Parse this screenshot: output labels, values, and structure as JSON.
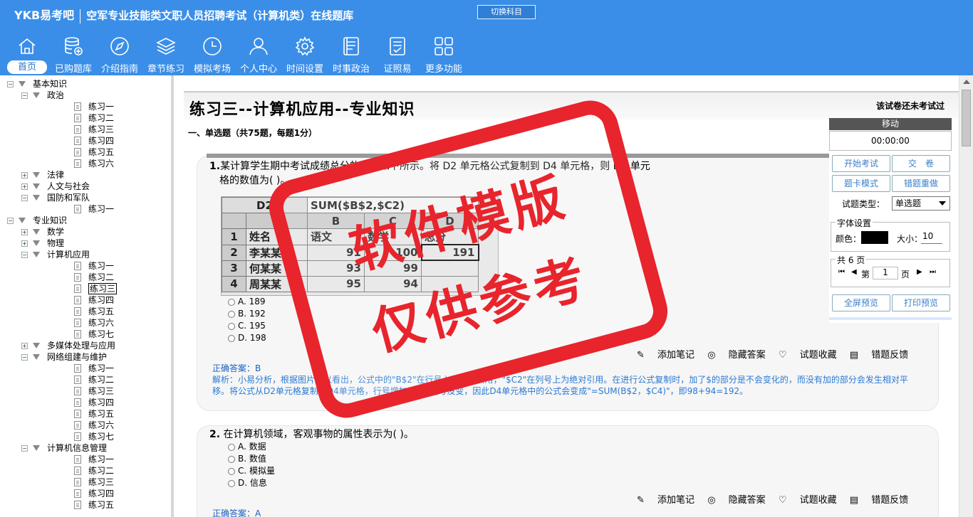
{
  "header": {
    "brand": "YKB易考吧",
    "exam_name": "空军专业技能类文职人员招聘考试（计算机类）在线题库",
    "switch_label": "切换科目"
  },
  "nav": [
    {
      "label": "首页",
      "icon": "home-icon"
    },
    {
      "label": "已购题库",
      "icon": "database-icon"
    },
    {
      "label": "介绍指南",
      "icon": "compass-icon"
    },
    {
      "label": "章节练习",
      "icon": "layers-icon"
    },
    {
      "label": "模拟考场",
      "icon": "clock-icon"
    },
    {
      "label": "个人中心",
      "icon": "user-icon"
    },
    {
      "label": "时间设置",
      "icon": "gear-icon"
    },
    {
      "label": "时事政治",
      "icon": "news-icon"
    },
    {
      "label": "证照易",
      "icon": "checklist-icon"
    },
    {
      "label": "更多功能",
      "icon": "grid-icon"
    }
  ],
  "tree": [
    {
      "level": 0,
      "label": "基本知识",
      "kind": "folder"
    },
    {
      "level": 1,
      "label": "政治",
      "kind": "folder"
    },
    {
      "level": 2,
      "label": "练习一",
      "kind": "doc"
    },
    {
      "level": 2,
      "label": "练习二",
      "kind": "doc"
    },
    {
      "level": 2,
      "label": "练习三",
      "kind": "doc"
    },
    {
      "level": 2,
      "label": "练习四",
      "kind": "doc"
    },
    {
      "level": 2,
      "label": "练习五",
      "kind": "doc"
    },
    {
      "level": 2,
      "label": "练习六",
      "kind": "doc"
    },
    {
      "level": 1,
      "label": "法律",
      "kind": "collapsed"
    },
    {
      "level": 1,
      "label": "人文与社会",
      "kind": "collapsed"
    },
    {
      "level": 1,
      "label": "国防和军队",
      "kind": "folder"
    },
    {
      "level": 2,
      "label": "练习一",
      "kind": "doc"
    },
    {
      "level": 0,
      "label": "专业知识",
      "kind": "folder"
    },
    {
      "level": 1,
      "label": "数学",
      "kind": "collapsed"
    },
    {
      "level": 1,
      "label": "物理",
      "kind": "collapsed"
    },
    {
      "level": 1,
      "label": "计算机应用",
      "kind": "folder"
    },
    {
      "level": 2,
      "label": "练习一",
      "kind": "doc"
    },
    {
      "level": 2,
      "label": "练习二",
      "kind": "doc"
    },
    {
      "level": 2,
      "label": "练习三",
      "kind": "doc",
      "selected": true
    },
    {
      "level": 2,
      "label": "练习四",
      "kind": "doc"
    },
    {
      "level": 2,
      "label": "练习五",
      "kind": "doc"
    },
    {
      "level": 2,
      "label": "练习六",
      "kind": "doc"
    },
    {
      "level": 2,
      "label": "练习七",
      "kind": "doc"
    },
    {
      "level": 1,
      "label": "多媒体处理与应用",
      "kind": "collapsed"
    },
    {
      "level": 1,
      "label": "网络组建与维护",
      "kind": "folder"
    },
    {
      "level": 2,
      "label": "练习一",
      "kind": "doc"
    },
    {
      "level": 2,
      "label": "练习二",
      "kind": "doc"
    },
    {
      "level": 2,
      "label": "练习三",
      "kind": "doc"
    },
    {
      "level": 2,
      "label": "练习四",
      "kind": "doc"
    },
    {
      "level": 2,
      "label": "练习五",
      "kind": "doc"
    },
    {
      "level": 2,
      "label": "练习六",
      "kind": "doc"
    },
    {
      "level": 2,
      "label": "练习七",
      "kind": "doc"
    },
    {
      "level": 1,
      "label": "计算机信息管理",
      "kind": "folder"
    },
    {
      "level": 2,
      "label": "练习一",
      "kind": "doc"
    },
    {
      "level": 2,
      "label": "练习二",
      "kind": "doc"
    },
    {
      "level": 2,
      "label": "练习三",
      "kind": "doc"
    },
    {
      "level": 2,
      "label": "练习四",
      "kind": "doc"
    },
    {
      "level": 2,
      "label": "练习五",
      "kind": "doc"
    }
  ],
  "paper": {
    "title": "练习三--计算机应用--专业知识",
    "status": "该试卷还未考试过",
    "section": "一、单选题（共75题，每题1分）"
  },
  "q1": {
    "num": "1.",
    "text_line1": "某计算学生期中考试成绩总分的表格如下所示。将 D2 单元格公式复制到 D4 单元格，则 D4 单元",
    "text_line2": "格的数值为(  )。",
    "sheet": {
      "namebox": "D2",
      "formula": "SUM($B$2,$C2)",
      "cols": [
        "",
        "A",
        "B",
        "C",
        "D"
      ],
      "rows": [
        [
          "1",
          "姓名",
          "语文",
          "数学",
          "总分"
        ],
        [
          "2",
          "李某某",
          "91",
          "100",
          "191"
        ],
        [
          "3",
          "何某某",
          "93",
          "99",
          ""
        ],
        [
          "4",
          "周某某",
          "95",
          "94",
          ""
        ]
      ]
    },
    "options": [
      "A. 189",
      "B. 192",
      "C. 195",
      "D. 198"
    ],
    "answer": "正确答案：B",
    "analysis": "解析：小易分析，根据图片可以看出，公式中的\"B$2\"在行号上为绝对引用，\"$C2\"在列号上为绝对引用。在进行公式复制时，加了$的部分是不会变化的，而没有加的部分会发生相对平移。将公式从D2单元格复制到D4单元格，行号增加了2而列号没变，因此D4单元格中的公式会变成\"=SUM(B$2，$C4)\"，即98+94=192。"
  },
  "q2": {
    "num": "2.",
    "text": "在计算机领域，客观事物的属性表示为(  )。",
    "options": [
      "A. 数据",
      "B. 数值",
      "C. 模拟量",
      "D. 信息"
    ],
    "answer": "正确答案：A"
  },
  "actions": {
    "note": "添加笔记",
    "hide": "隐藏答案",
    "fav": "试题收藏",
    "report": "错题反馈"
  },
  "panel": {
    "move": "移动",
    "timer": "00:00:00",
    "start": "开始考试",
    "submit": "交　卷",
    "card_mode": "题卡模式",
    "redo": "错题重做",
    "type_label": "试题类型：",
    "type_value": "单选题",
    "font_legend": "字体设置",
    "color_label": "颜色：",
    "size_label": "大小：",
    "size_value": "10",
    "pages_legend": "共 6 页",
    "page_prefix": "第",
    "page_value": "1",
    "page_suffix": "页",
    "fullscreen": "全屏预览",
    "print": "打印预览"
  },
  "watermark": {
    "line1": "软件模版",
    "line2": "仅供参考"
  },
  "colors": {
    "header_bg": "#3a8ee8",
    "stamp_red": "#e8242c",
    "answer_blue": "#1a5fc0"
  }
}
